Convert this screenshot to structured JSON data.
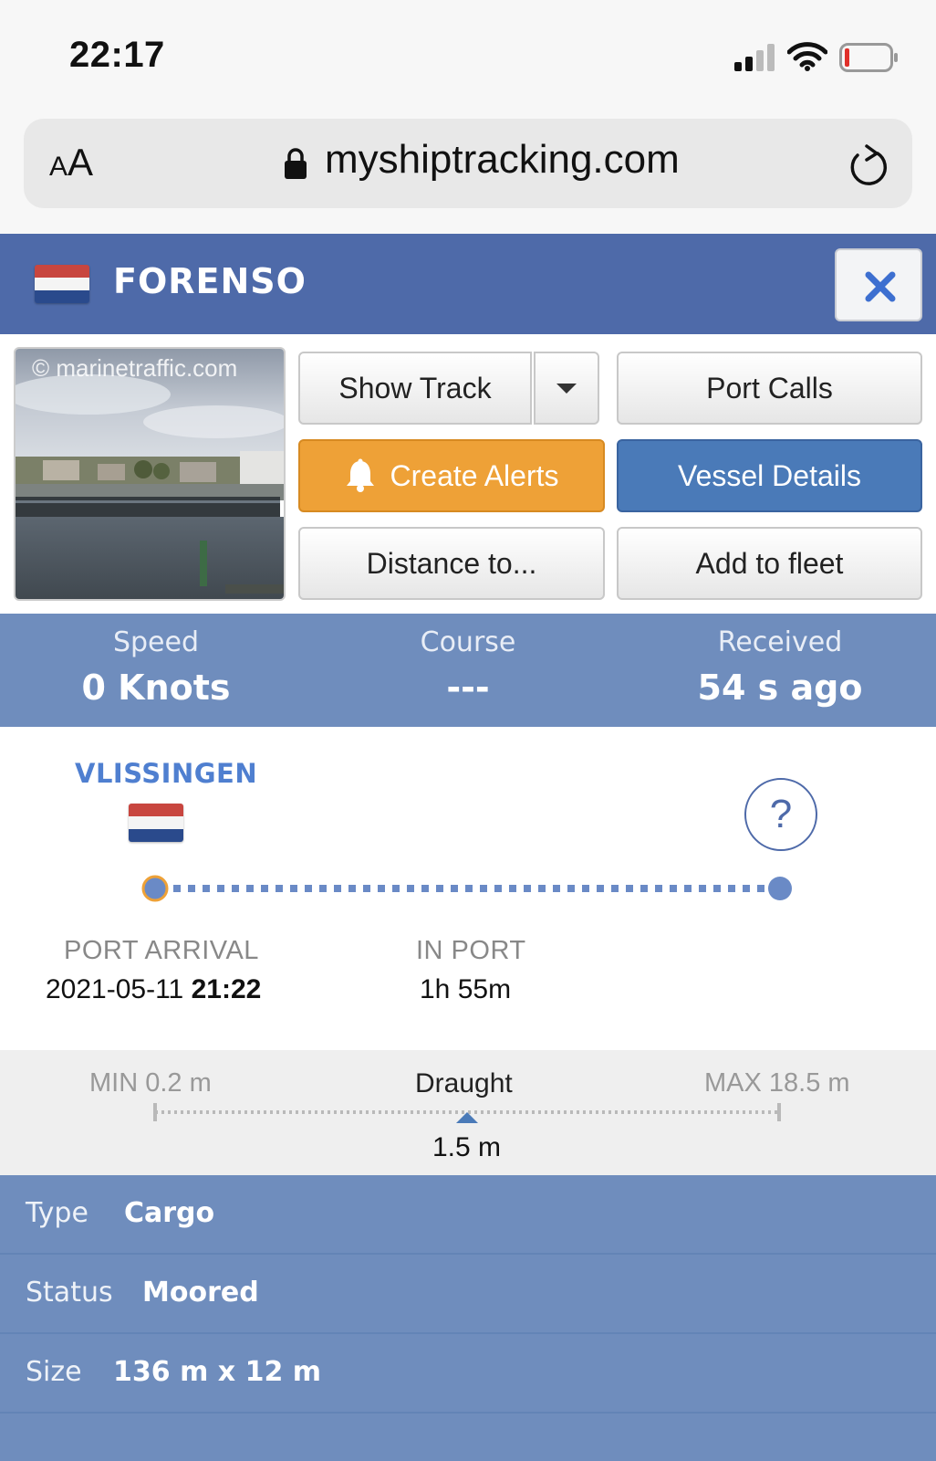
{
  "status_bar": {
    "time": "22:17"
  },
  "browser": {
    "text_size_label_small": "A",
    "text_size_label_large": "A",
    "url": "myshiptracking.com"
  },
  "vessel": {
    "name": "FORENSO"
  },
  "photo": {
    "credit": "© marinetraffic.com"
  },
  "actions": {
    "show_track": "Show Track",
    "port_calls": "Port Calls",
    "create_alerts": "Create Alerts",
    "vessel_details": "Vessel Details",
    "distance_to": "Distance to...",
    "add_to_fleet": "Add to fleet"
  },
  "stats": [
    {
      "label": "Speed",
      "value": "0 Knots"
    },
    {
      "label": "Course",
      "value": "---"
    },
    {
      "label": "Received",
      "value": "54 s ago"
    }
  ],
  "port": {
    "name": "VLISSINGEN",
    "help_symbol": "?",
    "arrival_label": "PORT ARRIVAL",
    "arrival_date": "2021-05-11",
    "arrival_time": "21:22",
    "in_port_label": "IN PORT",
    "in_port_value": "1h 55m"
  },
  "draught": {
    "min_label": "MIN 0.2 m",
    "title": "Draught",
    "max_label": "MAX 18.5 m",
    "value_label": "1.5 m",
    "min": 0.2,
    "max": 18.5,
    "value": 1.5
  },
  "info": [
    {
      "label": "Type",
      "value": "Cargo"
    },
    {
      "label": "Status",
      "value": "Moored"
    },
    {
      "label": "Size",
      "value": "136 m x 12 m"
    }
  ],
  "colors": {
    "header_blue": "#4e6aa9",
    "stats_blue": "#6f8dbd",
    "alert_orange": "#eea137",
    "details_blue": "#4a7ab8",
    "port_name_blue": "#4f7fd0"
  }
}
